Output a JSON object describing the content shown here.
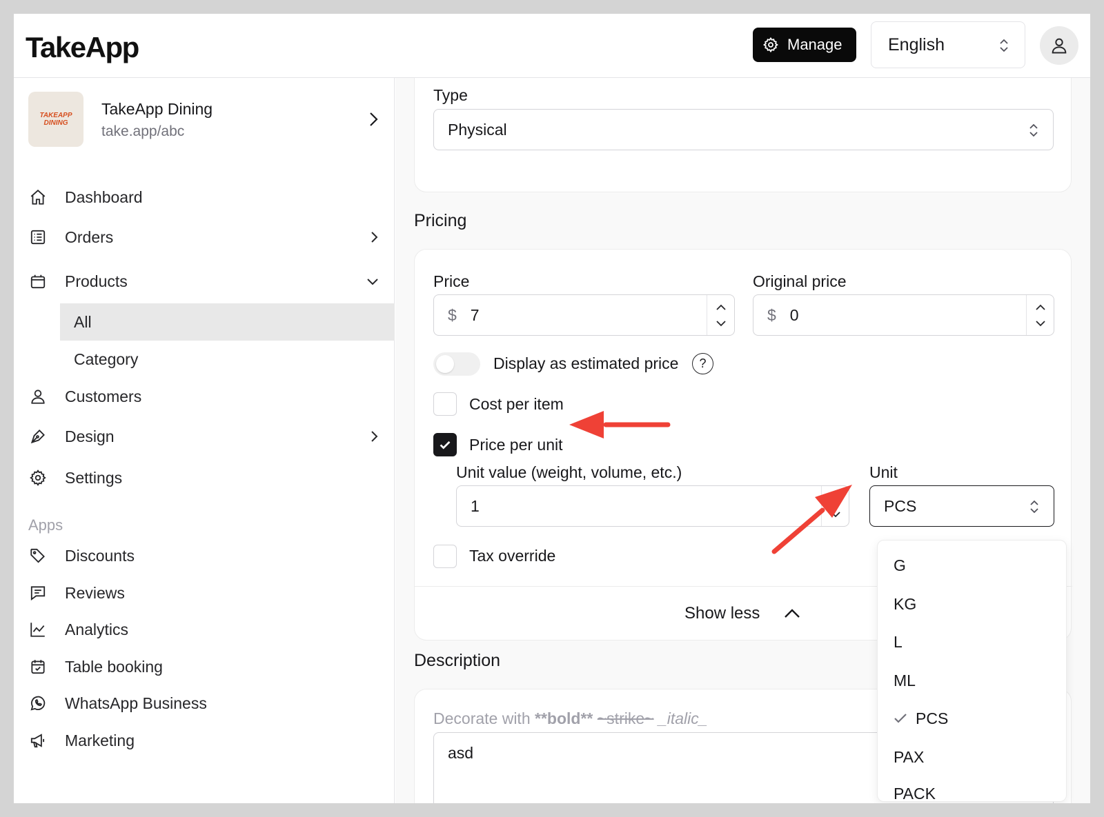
{
  "app": {
    "logo": "TakeApp"
  },
  "topbar": {
    "manage_label": "Manage",
    "language": "English"
  },
  "store": {
    "name": "TakeApp Dining",
    "url": "take.app/abc",
    "logo_text_1": "TAKEAPP",
    "logo_text_2": "DINING"
  },
  "nav": {
    "dashboard": "Dashboard",
    "orders": "Orders",
    "products": "Products",
    "products_all": "All",
    "products_category": "Category",
    "customers": "Customers",
    "design": "Design",
    "settings": "Settings",
    "apps_label": "Apps",
    "discounts": "Discounts",
    "reviews": "Reviews",
    "analytics": "Analytics",
    "table_booking": "Table booking",
    "whatsapp": "WhatsApp Business",
    "marketing": "Marketing"
  },
  "type_field": {
    "label": "Type",
    "value": "Physical"
  },
  "pricing": {
    "heading": "Pricing",
    "price_label": "Price",
    "price_currency": "$",
    "price_value": "7",
    "original_label": "Original price",
    "original_currency": "$",
    "original_value": "0",
    "estimated_label": "Display as estimated price",
    "estimated_help": "?",
    "cost_per_item": "Cost per item",
    "price_per_unit": "Price per unit",
    "unit_value_label": "Unit value (weight, volume, etc.)",
    "unit_value": "1",
    "unit_label": "Unit",
    "unit_selected": "PCS",
    "tax_override": "Tax override",
    "show_less": "Show less"
  },
  "description": {
    "heading": "Description",
    "hint_prefix": "Decorate with ",
    "hint_bold": "**bold**",
    "hint_strike": "~strike~",
    "hint_italic": "_italic_",
    "value": "asd"
  },
  "unit_options": [
    "G",
    "KG",
    "L",
    "ML",
    "PCS",
    "PAX",
    "PACK"
  ],
  "colors": {
    "accent": "#0a0a0a",
    "annotation_arrow": "#ef4136"
  }
}
